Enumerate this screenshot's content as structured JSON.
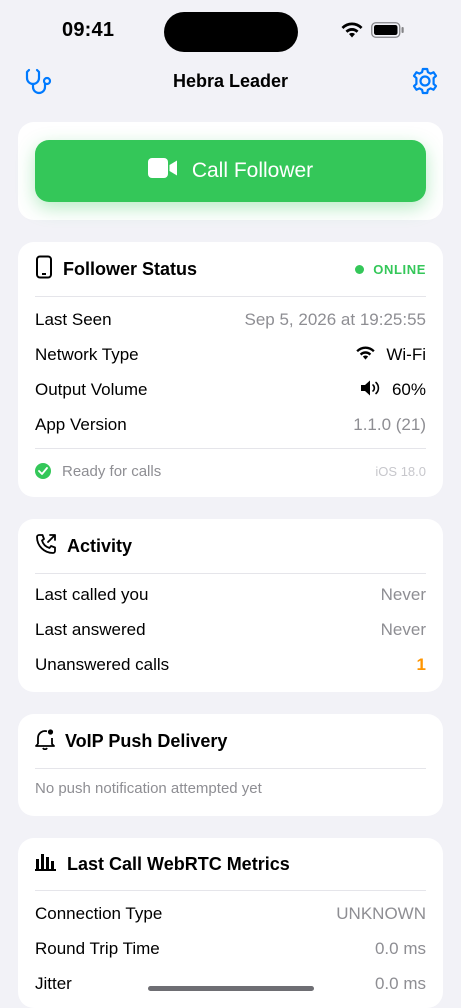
{
  "status_bar": {
    "time": "09:41"
  },
  "nav": {
    "title": "Hebra Leader",
    "left_icon": "stethoscope-icon",
    "right_icon": "gear-icon"
  },
  "call_button": {
    "label": "Call Follower",
    "icon": "video-camera-icon"
  },
  "follower_status": {
    "title": "Follower Status",
    "badge": "ONLINE",
    "rows": [
      {
        "label": "Last Seen",
        "value": "Sep 5, 2026 at 19:25:55"
      },
      {
        "label": "Network Type",
        "value": "Wi-Fi"
      },
      {
        "label": "Output Volume",
        "value": "60%"
      },
      {
        "label": "App Version",
        "value": "1.1.0 (21)"
      }
    ],
    "footer_text": "Ready for calls",
    "footer_right": "iOS 18.0"
  },
  "activity": {
    "title": "Activity",
    "rows": [
      {
        "label": "Last called you",
        "value": "Never"
      },
      {
        "label": "Last answered",
        "value": "Never"
      },
      {
        "label": "Unanswered calls",
        "value": "1"
      }
    ]
  },
  "voip": {
    "title": "VoIP Push Delivery",
    "message": "No push notification attempted yet"
  },
  "webrtc": {
    "title": "Last Call WebRTC Metrics",
    "rows": [
      {
        "label": "Connection Type",
        "value": "UNKNOWN"
      },
      {
        "label": "Round Trip Time",
        "value": "0.0 ms"
      },
      {
        "label": "Jitter",
        "value": "0.0 ms"
      }
    ]
  },
  "colors": {
    "accent": "#007aff",
    "green": "#34c759",
    "orange": "#ff9500",
    "background": "#f2f2f7"
  }
}
